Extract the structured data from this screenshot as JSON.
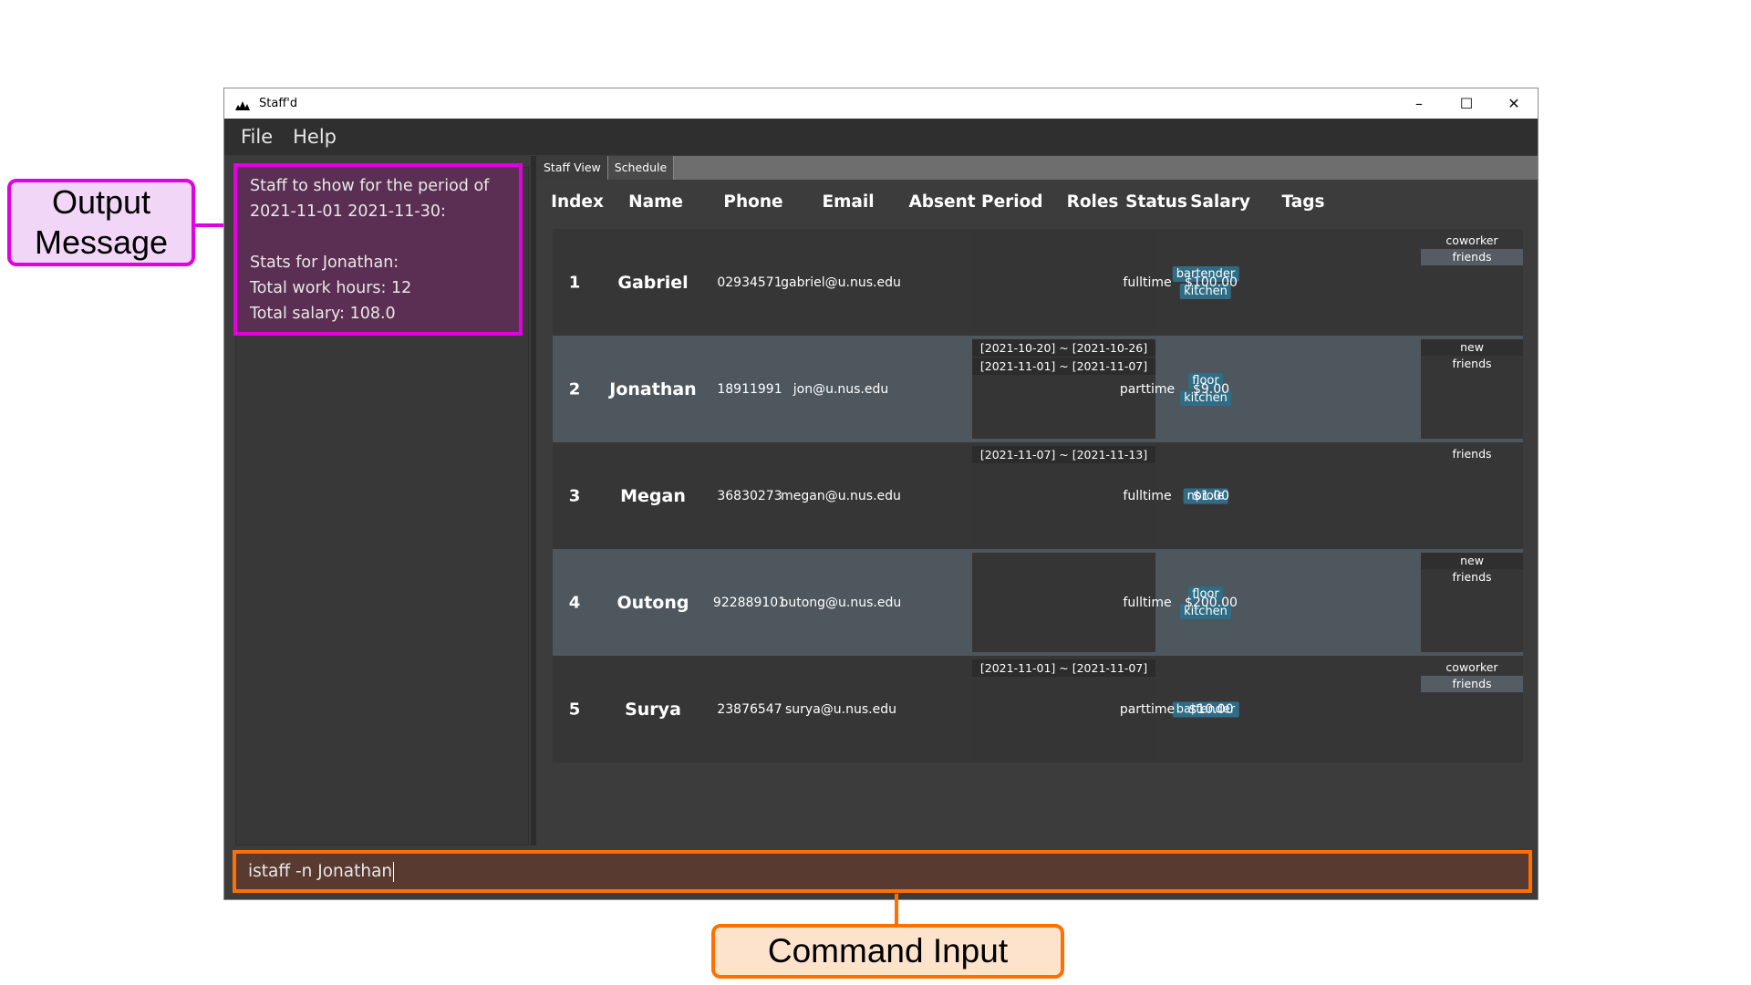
{
  "window": {
    "title": "Staff'd",
    "controls": [
      "–",
      "☐",
      "✕"
    ]
  },
  "menu": [
    "File",
    "Help"
  ],
  "result_display": "Staff to show for the period of\n2021-11-01 2021-11-30:\n\nStats for Jonathan:\nTotal work hours: 12\nTotal salary: 108.0",
  "tabs": [
    "Staff View",
    "Schedule"
  ],
  "columns": [
    "Index",
    "Name",
    "Phone",
    "Email",
    "Absent Period",
    "Roles",
    "Status",
    "Salary",
    "Tags"
  ],
  "staff": [
    {
      "index": "1",
      "name": "Gabriel",
      "phone": "02934571",
      "email": "gabriel@u.nus.edu",
      "absent": [],
      "roles": [
        "bartender",
        "kitchen"
      ],
      "status": "fulltime",
      "salary": "$100.00",
      "tags": [
        "coworker",
        "friends"
      ]
    },
    {
      "index": "2",
      "name": "Jonathan",
      "phone": "18911991",
      "email": "jon@u.nus.edu",
      "absent": [
        "[2021-10-20] ~ [2021-10-26]",
        "[2021-11-01] ~ [2021-11-07]"
      ],
      "roles": [
        "floor",
        "kitchen"
      ],
      "status": "parttime",
      "salary": "$9.00",
      "tags": [
        "new",
        "friends"
      ]
    },
    {
      "index": "3",
      "name": "Megan",
      "phone": "36830273",
      "email": "megan@u.nus.edu",
      "absent": [
        "[2021-11-07] ~ [2021-11-13]"
      ],
      "roles": [
        "norole"
      ],
      "status": "fulltime",
      "salary": "$1.00",
      "tags": [
        "friends"
      ]
    },
    {
      "index": "4",
      "name": "Outong",
      "phone": "922889101",
      "email": "outong@u.nus.edu",
      "absent": [],
      "roles": [
        "floor",
        "kitchen"
      ],
      "status": "fulltime",
      "salary": "$200.00",
      "tags": [
        "new",
        "friends"
      ]
    },
    {
      "index": "5",
      "name": "Surya",
      "phone": "23876547",
      "email": "surya@u.nus.edu",
      "absent": [
        "[2021-11-01] ~ [2021-11-07]"
      ],
      "roles": [
        "bartender"
      ],
      "status": "parttime",
      "salary": "$10.00",
      "tags": [
        "coworker",
        "friends"
      ]
    }
  ],
  "command": {
    "value": "istaff -n Jonathan"
  },
  "annotations": {
    "output_label": [
      "Output",
      "Message"
    ],
    "command_label": "Command Input"
  },
  "colors": {
    "result_border": "#e000e0",
    "command_border": "#ff7000",
    "role_badge": "#2f6d86"
  }
}
